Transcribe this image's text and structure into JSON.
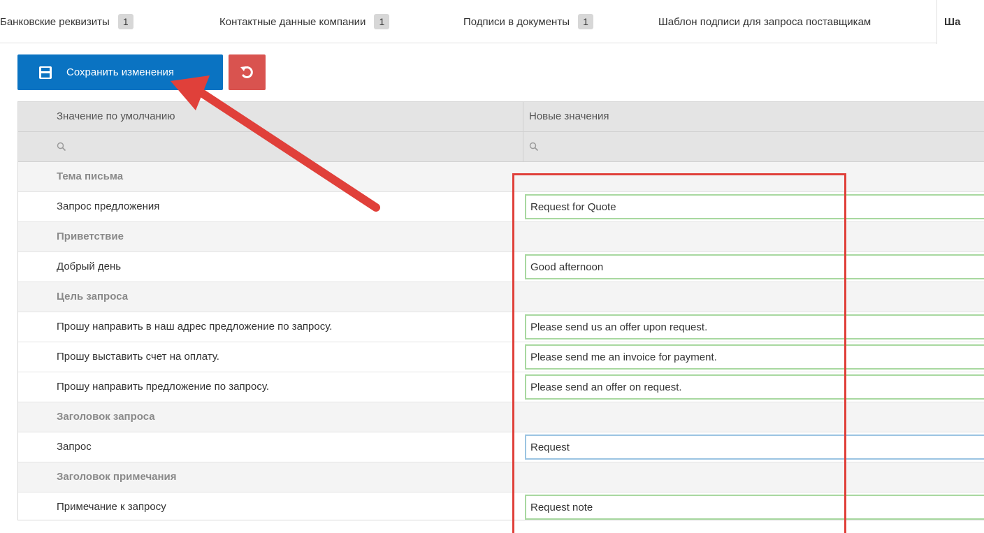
{
  "tabs": [
    {
      "label": "Банковские реквизиты",
      "badge": "1"
    },
    {
      "label": "Контактные данные компании",
      "badge": "1"
    },
    {
      "label": "Подписи в документы",
      "badge": "1"
    },
    {
      "label": "Шаблон подписи для запроса поставщикам",
      "badge": ""
    },
    {
      "label": "Ша",
      "badge": ""
    }
  ],
  "toolbar": {
    "save_label": "Сохранить изменения"
  },
  "grid": {
    "columns": [
      "Значение по умолчанию",
      "Новые значения"
    ],
    "rows": [
      {
        "type": "group",
        "label": "Тема письма"
      },
      {
        "type": "item",
        "label": "Запрос предложения",
        "value": "Request for Quote"
      },
      {
        "type": "group",
        "label": "Приветствие"
      },
      {
        "type": "item",
        "label": "Добрый день",
        "value": "Good afternoon"
      },
      {
        "type": "group",
        "label": "Цель запроса"
      },
      {
        "type": "item",
        "label": "Прошу направить в наш адрес предложение по запросу.",
        "value": "Please send us an offer upon request."
      },
      {
        "type": "item",
        "label": "Прошу выставить счет на оплату.",
        "value": "Please send me an invoice for payment."
      },
      {
        "type": "item",
        "label": "Прошу направить предложение по запросу.",
        "value": "Please send an offer on request."
      },
      {
        "type": "group",
        "label": "Заголовок запроса"
      },
      {
        "type": "item",
        "label": "Запрос",
        "value": "Request",
        "focused": true
      },
      {
        "type": "group",
        "label": "Заголовок примечания"
      },
      {
        "type": "item",
        "label": "Примечание к запросу",
        "value": "Request note"
      }
    ]
  },
  "colors": {
    "primary": "#0a73c2",
    "danger": "#d9534f",
    "annotation": "#e0403a",
    "valid_border": "#a8d8a0",
    "focus_border": "#9bc4e2"
  },
  "icons": {
    "save": "floppy-disk-icon",
    "undo": "undo-icon",
    "filter": "search-icon"
  }
}
